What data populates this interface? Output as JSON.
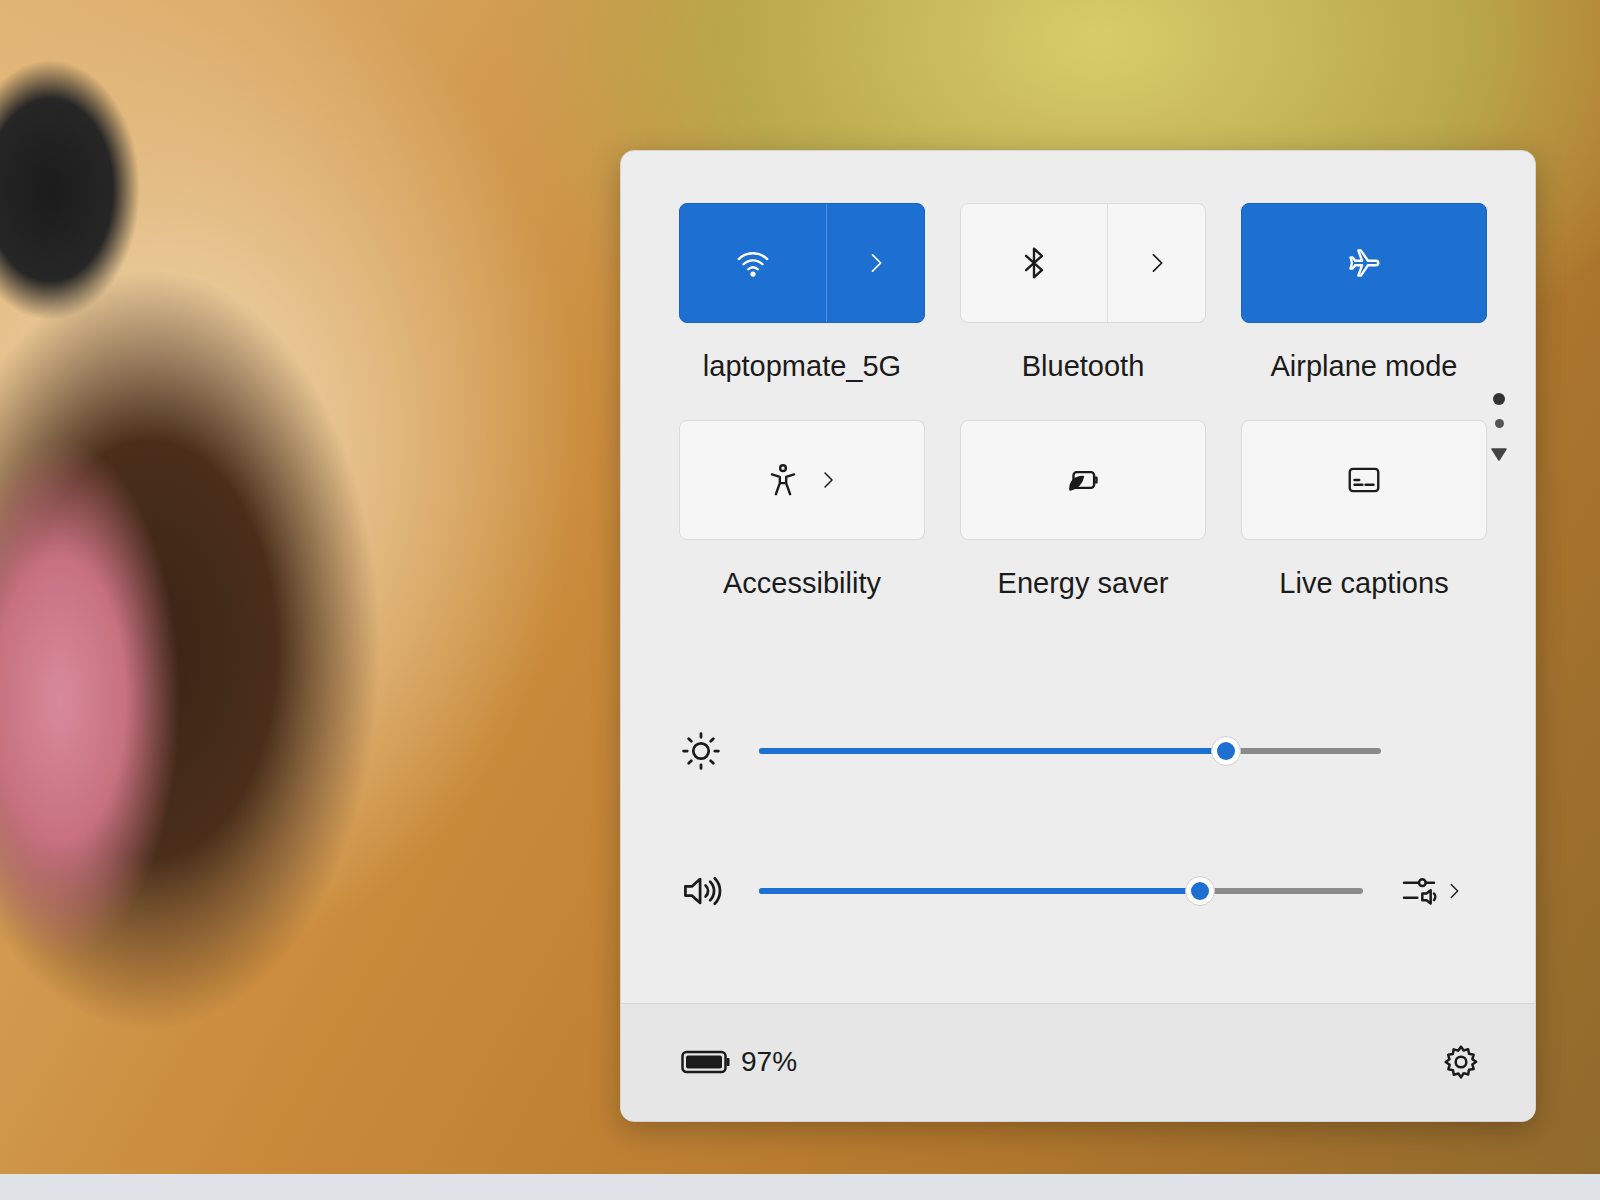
{
  "tiles": [
    {
      "label": "laptopmate_5G",
      "on": true,
      "kind": "split"
    },
    {
      "label": "Bluetooth",
      "on": false,
      "kind": "split"
    },
    {
      "label": "Airplane mode",
      "on": true,
      "kind": "single"
    },
    {
      "label": "Accessibility",
      "on": false,
      "kind": "inline"
    },
    {
      "label": "Energy saver",
      "on": false,
      "kind": "single"
    },
    {
      "label": "Live captions",
      "on": false,
      "kind": "single"
    }
  ],
  "pages": [
    {
      "selected": true
    },
    {
      "selected": false
    }
  ],
  "sliders": [
    {
      "kind": "brightness",
      "level": 0.75
    },
    {
      "kind": "volume",
      "level": 0.73
    }
  ],
  "battery": {
    "reading": "97%"
  }
}
